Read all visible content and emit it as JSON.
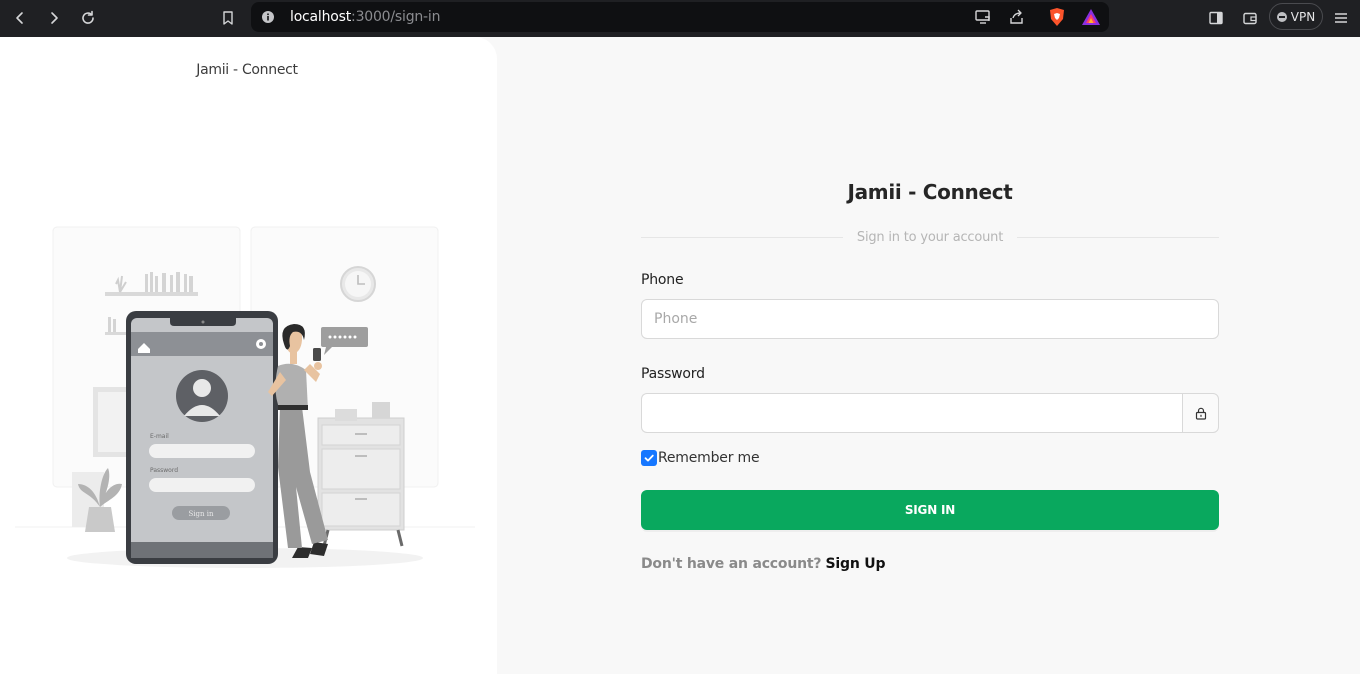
{
  "browser": {
    "url_host": "localhost",
    "url_path": ":3000/sign-in",
    "vpn_label": "VPN"
  },
  "left_panel": {
    "brand": "Jamii - Connect",
    "illustration": {
      "email_label": "E-mail",
      "password_label": "Password",
      "signin_label": "Sign in"
    }
  },
  "form": {
    "title": "Jamii - Connect",
    "subtitle": "Sign in to your account",
    "phone_label": "Phone",
    "phone_placeholder": "Phone",
    "phone_value": "",
    "password_label": "Password",
    "password_value": "",
    "remember_label": "Remember me",
    "remember_checked": true,
    "signin_button": "SIGN IN",
    "signup_question": "Don't have an account?",
    "signup_link": "Sign Up"
  },
  "colors": {
    "primary_button": "#09a85e",
    "checkbox": "#1677ff",
    "page_background": "#f8f8f8"
  }
}
